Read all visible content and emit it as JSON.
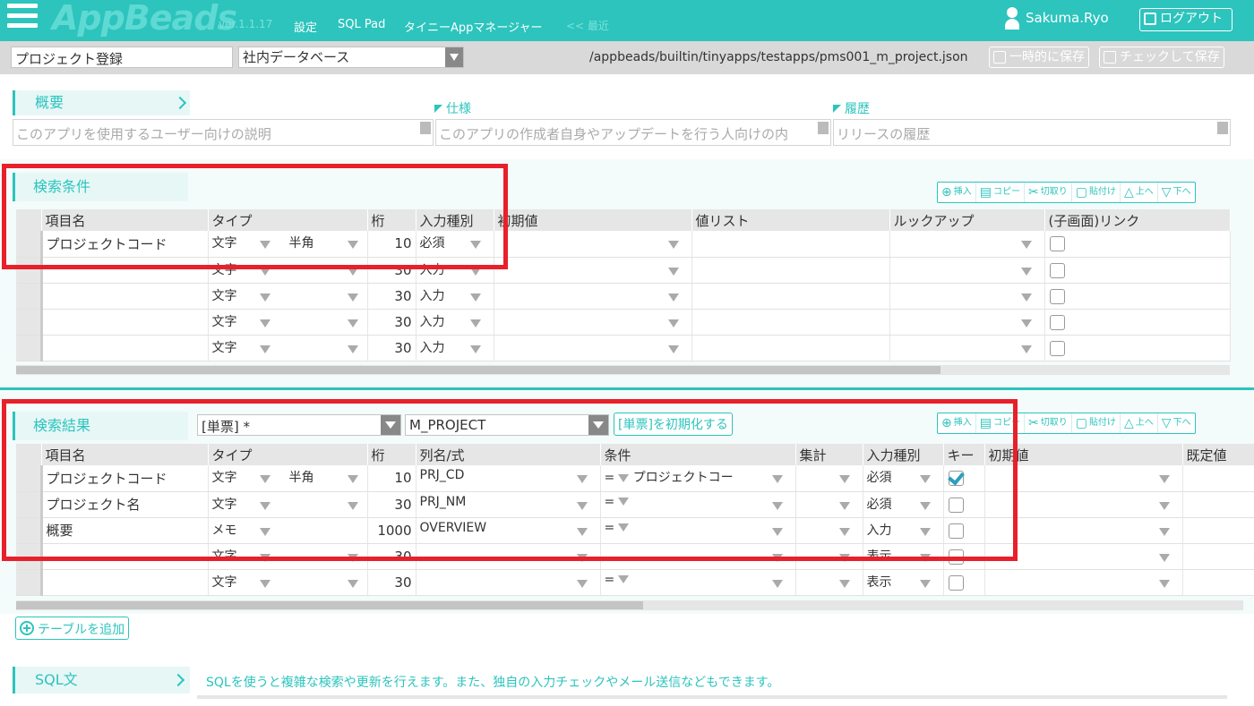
{
  "header": {
    "logo": "AppBeads",
    "version": "ver.1.1.17",
    "nav": [
      "設定",
      "SQL Pad",
      "タイニーAppマネージャー",
      "<< 最近"
    ],
    "user_name": "Sakuma.Ryo",
    "logout_label": "ログアウト"
  },
  "toolbar": {
    "project_name": "プロジェクト登録",
    "database": "社内データベース",
    "file_path": "/appbeads/builtin/tinyapps/testapps/pms001_m_project.json",
    "save_temp_label": "一時的に保存",
    "save_check_label": "チェックして保存"
  },
  "overview": {
    "title": "概要",
    "spec_label": "仕様",
    "history_label": "履歴",
    "desc_placeholder": "このアプリを使用するユーザー向けの説明",
    "spec_placeholder": "このアプリの作成者自身やアップデートを行う人向けの内",
    "history_placeholder": "リリースの履歴"
  },
  "row_buttons": {
    "insert": "挿入",
    "copy": "コピー",
    "cut": "切取り",
    "paste": "貼付け",
    "up": "上へ",
    "down": "下へ"
  },
  "search_conditions": {
    "title": "検索条件",
    "columns": [
      "項目名",
      "タイプ",
      "桁",
      "入力種別",
      "初期値",
      "値リスト",
      "ルックアップ",
      "(子画面)リンク"
    ],
    "rows": [
      {
        "name": "プロジェクトコード",
        "type": "文字",
        "sub": "半角",
        "digits": "10",
        "input": "必須",
        "checked": false
      },
      {
        "name": "",
        "type": "文字",
        "sub": "",
        "digits": "30",
        "input": "入力",
        "checked": false
      },
      {
        "name": "",
        "type": "文字",
        "sub": "",
        "digits": "30",
        "input": "入力",
        "checked": false
      },
      {
        "name": "",
        "type": "文字",
        "sub": "",
        "digits": "30",
        "input": "入力",
        "checked": false
      },
      {
        "name": "",
        "type": "文字",
        "sub": "",
        "digits": "30",
        "input": "入力",
        "checked": false
      }
    ]
  },
  "search_results": {
    "title": "検索結果",
    "form_select": "[単票] *",
    "table_select": "M_PROJECT",
    "init_button": "[単票]を初期化する",
    "columns": [
      "項目名",
      "タイプ",
      "桁",
      "列名/式",
      "条件",
      "集計",
      "入力種別",
      "キー",
      "初期値",
      "既定値"
    ],
    "rows": [
      {
        "name": "プロジェクトコード",
        "type": "文字",
        "sub": "半角",
        "digits": "10",
        "column": "PRJ_CD",
        "cond_op": "=",
        "cond_val": "プロジェクトコー",
        "input": "必須",
        "key": true
      },
      {
        "name": "プロジェクト名",
        "type": "文字",
        "sub": "",
        "digits": "30",
        "column": "PRJ_NM",
        "cond_op": "=",
        "cond_val": "",
        "input": "必須",
        "key": false
      },
      {
        "name": "概要",
        "type": "メモ",
        "sub": "",
        "digits": "1000",
        "column": "OVERVIEW",
        "cond_op": "=",
        "cond_val": "",
        "input": "入力",
        "key": false
      },
      {
        "name": "",
        "type": "文字",
        "sub": "",
        "digits": "30",
        "column": "",
        "cond_op": "",
        "cond_val": "",
        "input": "表示",
        "key": false
      },
      {
        "name": "",
        "type": "文字",
        "sub": "",
        "digits": "30",
        "column": "",
        "cond_op": "=",
        "cond_val": "",
        "input": "表示",
        "key": false
      }
    ]
  },
  "add_table_label": "テーブルを追加",
  "sql": {
    "title": "SQL文",
    "description": "SQLを使うと複雑な検索や更新を行えます。また、独自の入力チェックやメール送信などもできます。"
  },
  "colors": {
    "accent": "#2cc4bd",
    "highlight": "#e8202a"
  }
}
